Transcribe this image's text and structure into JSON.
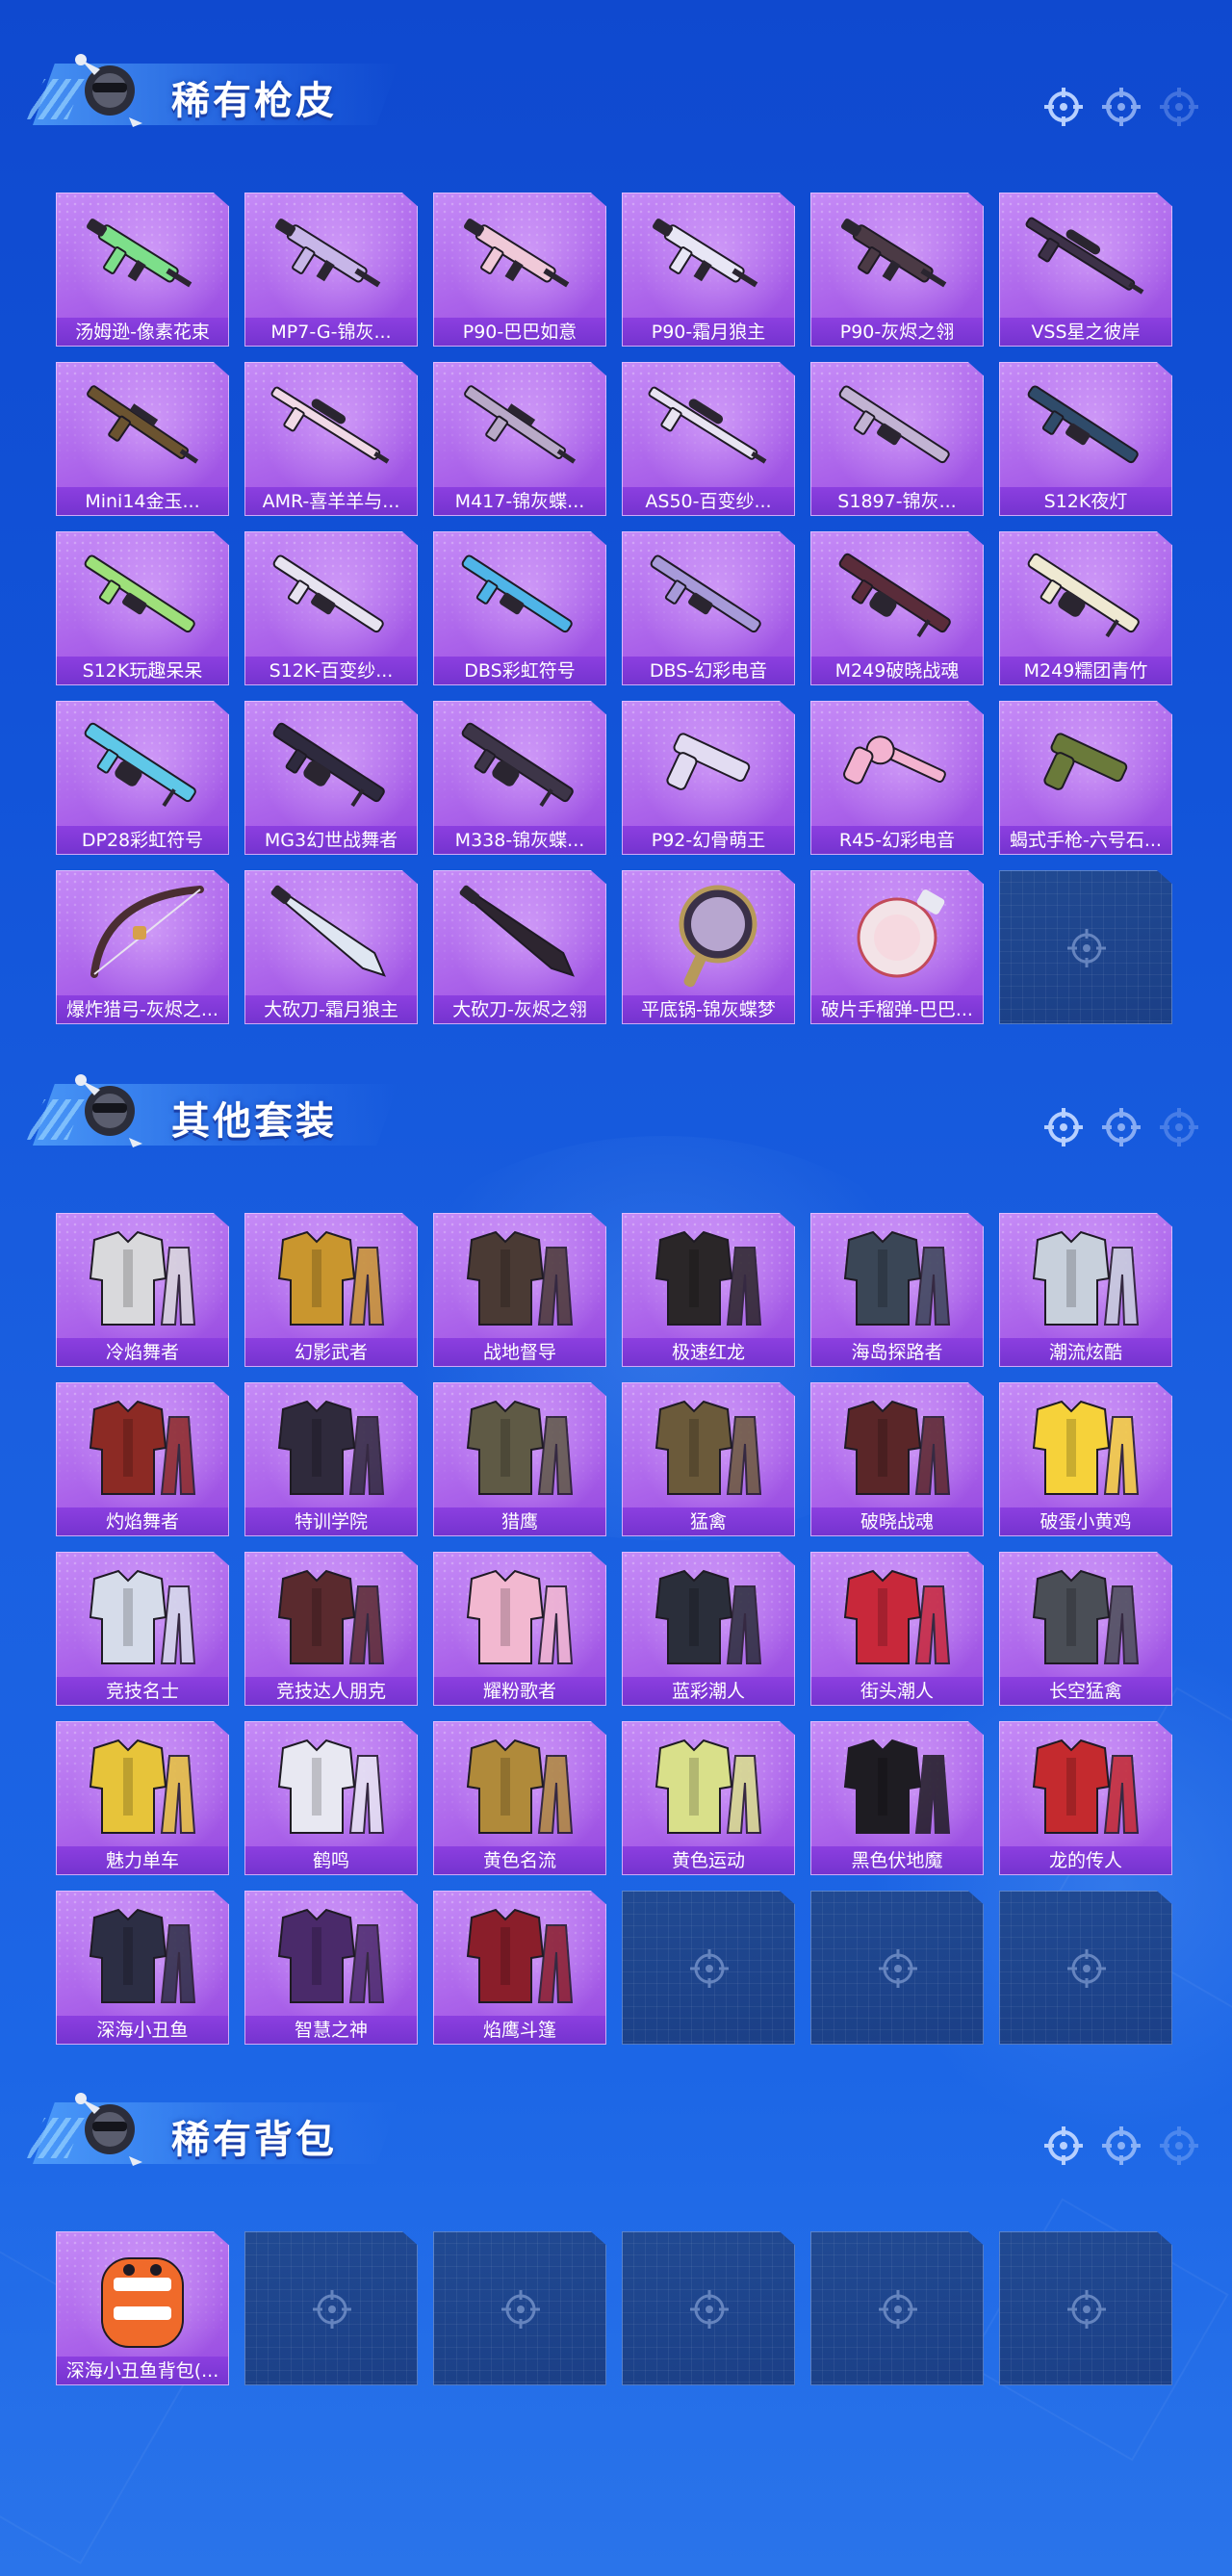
{
  "sections": [
    {
      "title": "稀有枪皮",
      "items": [
        {
          "label": "汤姆逊-像素花束",
          "icon": "smg-icon",
          "color": "#7ddf8a"
        },
        {
          "label": "MP7-G-锦灰...",
          "icon": "smg-icon",
          "color": "#c7b6e8"
        },
        {
          "label": "P90-巴巴如意",
          "icon": "smg-icon",
          "color": "#f0c9d8"
        },
        {
          "label": "P90-霜月狼主",
          "icon": "smg-icon",
          "color": "#e8e6f5"
        },
        {
          "label": "P90-灰烬之翎",
          "icon": "smg-icon",
          "color": "#4b3a45"
        },
        {
          "label": "VSS星之彼岸",
          "icon": "sniper-icon",
          "color": "#3d3148"
        },
        {
          "label": "Mini14金玉...",
          "icon": "rifle-icon",
          "color": "#6b5330"
        },
        {
          "label": "AMR-喜羊羊与...",
          "icon": "sniper-icon",
          "color": "#f1d9e6"
        },
        {
          "label": "M417-锦灰蝶...",
          "icon": "rifle-icon",
          "color": "#b9a9c8"
        },
        {
          "label": "AS50-百变纱...",
          "icon": "sniper-icon",
          "color": "#e8e4f2"
        },
        {
          "label": "S1897-锦灰...",
          "icon": "shotgun-icon",
          "color": "#c2b3d3"
        },
        {
          "label": "S12K夜灯",
          "icon": "shotgun-icon",
          "color": "#2f4b6a"
        },
        {
          "label": "S12K玩趣呆呆",
          "icon": "shotgun-icon",
          "color": "#9ee07a"
        },
        {
          "label": "S12K-百变纱...",
          "icon": "shotgun-icon",
          "color": "#e7e3f0"
        },
        {
          "label": "DBS彩虹符号",
          "icon": "shotgun-icon",
          "color": "#4fb5e8"
        },
        {
          "label": "DBS-幻彩电音",
          "icon": "shotgun-icon",
          "color": "#a79ad9"
        },
        {
          "label": "M249破晓战魂",
          "icon": "lmg-icon",
          "color": "#5a2c3a"
        },
        {
          "label": "M249糯团青竹",
          "icon": "lmg-icon",
          "color": "#efe9d2"
        },
        {
          "label": "DP28彩虹符号",
          "icon": "lmg-icon",
          "color": "#5fc8e8"
        },
        {
          "label": "MG3幻世战舞者",
          "icon": "lmg-icon",
          "color": "#2e2a3e"
        },
        {
          "label": "M338-锦灰蝶...",
          "icon": "lmg-icon",
          "color": "#3d3548"
        },
        {
          "label": "P92-幻骨萌王",
          "icon": "pistol-icon",
          "color": "#e2dcf2"
        },
        {
          "label": "R45-幻彩电音",
          "icon": "revolver-icon",
          "color": "#f3b3d0"
        },
        {
          "label": "蝎式手枪-六号石...",
          "icon": "pistol-icon",
          "color": "#6a7a3a"
        },
        {
          "label": "爆炸猎弓-灰烬之...",
          "icon": "bow-icon",
          "color": "#4a2d32"
        },
        {
          "label": "大砍刀-霜月狼主",
          "icon": "machete-icon",
          "color": "#dfe6f2"
        },
        {
          "label": "大砍刀-灰烬之翎",
          "icon": "machete-icon",
          "color": "#2d2530"
        },
        {
          "label": "平底锅-锦灰蝶梦",
          "icon": "pan-icon",
          "color": "#b7a6cf"
        },
        {
          "label": "破片手榴弹-巴巴...",
          "icon": "grenade-icon",
          "color": "#f3e3e7"
        },
        {
          "label": "",
          "icon": "empty-slot-icon"
        }
      ]
    },
    {
      "title": "其他套装",
      "items": [
        {
          "label": "冷焰舞者",
          "icon": "outfit-icon",
          "color": "#d9d9dc"
        },
        {
          "label": "幻影武者",
          "icon": "outfit-icon",
          "color": "#c9962e"
        },
        {
          "label": "战地督导",
          "icon": "outfit-icon",
          "color": "#4a3a34"
        },
        {
          "label": "极速红龙",
          "icon": "outfit-icon",
          "color": "#2a2628"
        },
        {
          "label": "海岛探路者",
          "icon": "outfit-icon",
          "color": "#3a4656"
        },
        {
          "label": "潮流炫酷",
          "icon": "outfit-icon",
          "color": "#c8d0dc"
        },
        {
          "label": "灼焰舞者",
          "icon": "outfit-icon",
          "color": "#8c2a24"
        },
        {
          "label": "特训学院",
          "icon": "outfit-icon",
          "color": "#2f2a3c"
        },
        {
          "label": "猎鹰",
          "icon": "outfit-icon",
          "color": "#5f5a45"
        },
        {
          "label": "猛禽",
          "icon": "outfit-icon",
          "color": "#6b5a3a"
        },
        {
          "label": "破晓战魂",
          "icon": "outfit-icon",
          "color": "#5a2628"
        },
        {
          "label": "破蛋小黄鸡",
          "icon": "outfit-icon",
          "color": "#f6d23a"
        },
        {
          "label": "竞技名士",
          "icon": "outfit-icon",
          "color": "#d6dcea"
        },
        {
          "label": "竞技达人朋克",
          "icon": "outfit-icon",
          "color": "#5a2a2e"
        },
        {
          "label": "耀粉歌者",
          "icon": "outfit-icon",
          "color": "#f2b8d0"
        },
        {
          "label": "蓝彩潮人",
          "icon": "outfit-icon",
          "color": "#2a2e3a"
        },
        {
          "label": "街头潮人",
          "icon": "outfit-icon",
          "color": "#c8283a"
        },
        {
          "label": "长空猛禽",
          "icon": "outfit-icon",
          "color": "#4a4e56"
        },
        {
          "label": "魅力单车",
          "icon": "outfit-icon",
          "color": "#e7c43a"
        },
        {
          "label": "鹤鸣",
          "icon": "outfit-icon",
          "color": "#e8e8f2"
        },
        {
          "label": "黄色名流",
          "icon": "outfit-icon",
          "color": "#b08a3a"
        },
        {
          "label": "黄色运动",
          "icon": "outfit-icon",
          "color": "#d9e08a"
        },
        {
          "label": "黑色伏地魔",
          "icon": "outfit-icon",
          "color": "#1e1c22"
        },
        {
          "label": "龙的传人",
          "icon": "outfit-icon",
          "color": "#c42a2e"
        },
        {
          "label": "深海小丑鱼",
          "icon": "outfit-icon",
          "color": "#2c2e44"
        },
        {
          "label": "智慧之神",
          "icon": "outfit-icon",
          "color": "#4a2a6a"
        },
        {
          "label": "焰鹰斗篷",
          "icon": "outfit-icon",
          "color": "#8a1e2a"
        },
        {
          "label": "",
          "icon": "empty-slot-icon"
        },
        {
          "label": "",
          "icon": "empty-slot-icon"
        },
        {
          "label": "",
          "icon": "empty-slot-icon"
        }
      ]
    },
    {
      "title": "稀有背包",
      "items": [
        {
          "label": "深海小丑鱼背包(...",
          "icon": "backpack-icon",
          "color": "#f06a2a"
        },
        {
          "label": "",
          "icon": "empty-slot-icon"
        },
        {
          "label": "",
          "icon": "empty-slot-icon"
        },
        {
          "label": "",
          "icon": "empty-slot-icon"
        },
        {
          "label": "",
          "icon": "empty-slot-icon"
        },
        {
          "label": "",
          "icon": "empty-slot-icon"
        }
      ]
    }
  ]
}
